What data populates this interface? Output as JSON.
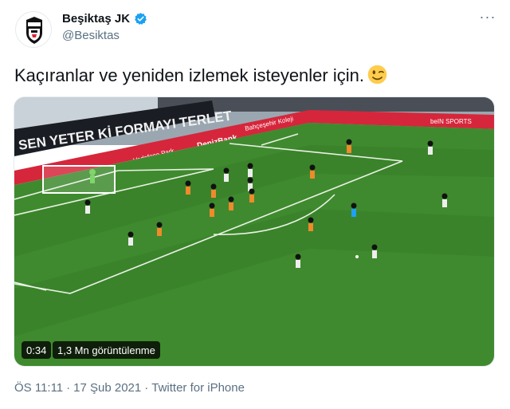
{
  "author": {
    "name": "Beşiktaş JK",
    "handle": "@Besiktas",
    "verified": true
  },
  "more_glyph": "···",
  "tweet": {
    "text": "Kaçıranlar ve yeniden izlemek isteyenler için.",
    "emoji": "winking-face"
  },
  "media": {
    "duration": "0:34",
    "views": "1,3 Mn görüntülenme",
    "stadium_banner": "SEN YETER Kİ FORMAYI TERLET",
    "ad_boards": [
      "Vodafone Park",
      "DenizBank",
      "Bahçeşehir Koleji",
      "beIN SPORTS"
    ]
  },
  "footer": {
    "time": "ÖS 11:11",
    "separator": "·",
    "date": "17 Şub 2021",
    "source": "Twitter for iPhone"
  },
  "colors": {
    "pitch": "#3f8a2e",
    "pitch_dark": "#357a26",
    "ad_board": "#d6263b",
    "twitter_blue": "#1da1f2",
    "secondary_text": "#5b7083"
  }
}
